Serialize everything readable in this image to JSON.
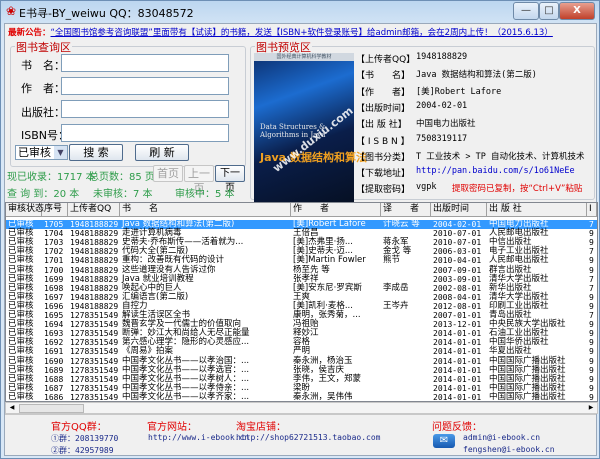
{
  "window": {
    "title": "E书寻-BY_weiwu QQ：83048572",
    "min": "—",
    "max": "□",
    "close": "X"
  },
  "notice": {
    "label": "最新公告：",
    "text": "“全国图书馆参考咨询联盟”里面带有【试读】的书籍，发送【ISBN+软件登录账号】给admin邮箱，会在2周内上传！（2015.6.13）"
  },
  "search": {
    "group_title": "图书查询区",
    "fields": [
      {
        "label": "书　名：",
        "value": ""
      },
      {
        "label": "作　者：",
        "value": ""
      },
      {
        "label": "出版社：",
        "value": ""
      },
      {
        "label": "ISBN号：",
        "value": ""
      }
    ],
    "status_select": "已审核",
    "search_button": "搜 索",
    "refresh_button": "刷 新"
  },
  "stats": {
    "collected": "现已收录：1717 本",
    "total_pages": "总页数：85 页",
    "found": "查 询 到：20 本",
    "unreviewed": "未审核：7 本",
    "reviewing": "审核中：5 本"
  },
  "pager": {
    "first": "首页",
    "prev": "上一页",
    "next": "下一页"
  },
  "preview": {
    "group_title": "图书预览区",
    "cover_top": "国外经典计算机科学教材",
    "cover_en": "Data Structures & Algorithms in Java",
    "cover_cn": "Java 数据结构和算法",
    "cover_watermark": "www.duxiu.com",
    "info": [
      {
        "k": "【上传者QQ】",
        "v": "1948188829"
      },
      {
        "k": "【书　　名】",
        "v": "Java 数据结构和算法(第二版)"
      },
      {
        "k": "【作　　者】",
        "v": "[美]Robert Lafore"
      },
      {
        "k": "【出版时间】",
        "v": "2004-02-01"
      },
      {
        "k": "【出 版 社】",
        "v": "中国电力出版社"
      },
      {
        "k": "【 I S B N 】",
        "v": "7508319117"
      },
      {
        "k": "【图书分类】",
        "v": "T 工业技术 > TP 自动化技术、计算机技术"
      },
      {
        "k": "【下载地址】",
        "v": "http://pan.baidu.com/s/1o61NeEe"
      },
      {
        "k": "【提取密码】",
        "v": "vgpk"
      }
    ],
    "copied_msg": "提取密码已复制，按“Ctrl+V”粘贴"
  },
  "table": {
    "headers": [
      "审核状态",
      "序号",
      "上传者QQ",
      "书　　名",
      "作　　者",
      "译　　者",
      "出版时间",
      "出 版 社",
      "I"
    ],
    "rows": [
      [
        "已审核",
        "1705",
        "1948188829",
        "Java 数据结构和算法(第二版)",
        "[美]Robert Lafore",
        "计晓云 等",
        "2004-02-01",
        "中国电力出版社",
        "7"
      ],
      [
        "已审核",
        "1704",
        "1948188829",
        "走进计算机病毒",
        "王倍昌",
        "",
        "2010-07-01",
        "人民邮电出版社",
        "9"
      ],
      [
        "已审核",
        "1703",
        "1948188829",
        "史蒂夫·乔布斯传——活着就为...",
        "[美]杰弗里·扬...",
        "蒋永军",
        "2010-07-01",
        "中信出版社",
        "9"
      ],
      [
        "已审核",
        "1702",
        "1948188829",
        "代码大全(第二版)",
        "[美]史蒂夫·迈...",
        "金戈 等",
        "2006-03-01",
        "电子工业出版社",
        "7"
      ],
      [
        "已审核",
        "1701",
        "1948188829",
        "重构：改善既有代码的设计",
        "[美]Martin Fowler",
        "熊节",
        "2010-04-01",
        "人民邮电出版社",
        "9"
      ],
      [
        "已审核",
        "1700",
        "1948188829",
        "这些道理没有人告诉过你",
        "杨至先 等",
        "",
        "2007-09-01",
        "群言出版社",
        "9"
      ],
      [
        "已审核",
        "1699",
        "1948188829",
        "Java 就业培训教程",
        "张孝祥",
        "",
        "2003-09-01",
        "清华大学出版社",
        "7"
      ],
      [
        "已审核",
        "1698",
        "1948188829",
        "唤起心中的巨人",
        "[美]安东尼·罗宾斯",
        "李成岳",
        "2002-08-01",
        "新华出版社",
        "7"
      ],
      [
        "已审核",
        "1697",
        "1948188829",
        "汇编语言(第二版)",
        "王爽",
        "",
        "2008-04-01",
        "清华大学出版社",
        "9"
      ],
      [
        "已审核",
        "1696",
        "1948188829",
        "自控力",
        "[美]凯利·麦格...",
        "王岑卉",
        "2012-08-01",
        "印刷工业出版社",
        "9"
      ],
      [
        "已审核",
        "1695",
        "1278351549",
        "解读生活误区全书",
        "康明，张秀菊，...",
        "",
        "2007-01-01",
        "青岛出版社",
        "7"
      ],
      [
        "已审核",
        "1694",
        "1278351549",
        "魏晋玄学及一代儒士的价值取向",
        "冯祖贻",
        "",
        "2013-12-01",
        "中央民族大学出版社",
        "9"
      ],
      [
        "已审核",
        "1693",
        "1278351549",
        "断弹：妙江大和尚给人无尽正能量",
        "释妙江",
        "",
        "2014-01-01",
        "石油工业出版社",
        "9"
      ],
      [
        "已审核",
        "1692",
        "1278351549",
        "第六感心理学：隐形的心灵感应...",
        "容格",
        "",
        "2014-01-01",
        "中国华侨出版社",
        "9"
      ],
      [
        "已审核",
        "1691",
        "1278351549",
        "《周易》拍案",
        "严明",
        "",
        "2014-01-01",
        "华夏出版社",
        "9"
      ],
      [
        "已审核",
        "1690",
        "1278351549",
        "中国孝文化丛书——以孝治国：...",
        "秦永洲，杨治玉",
        "",
        "2014-01-01",
        "中国国际广播出版社",
        "9"
      ],
      [
        "已审核",
        "1689",
        "1278351549",
        "中国孝文化丛书——以孝选官：...",
        "张晓，侯吉庆",
        "",
        "2014-01-01",
        "中国国际广播出版社",
        "9"
      ],
      [
        "已审核",
        "1688",
        "1278351549",
        "中国孝文化丛书——以孝树人：...",
        "李伟，王文，郑蒙",
        "",
        "2014-01-01",
        "中国国际广播出版社",
        "9"
      ],
      [
        "已审核",
        "1687",
        "1278351549",
        "中国孝文化丛书——以孝侍亲：...",
        "梁盼",
        "",
        "2014-01-01",
        "中国国际广播出版社",
        "9"
      ],
      [
        "已审核",
        "1686",
        "1278351549",
        "中国孝文化丛书——以孝齐家：...",
        "秦永洲，吴伟伟",
        "",
        "2014-01-01",
        "中国国际广播出版社",
        "9"
      ]
    ]
  },
  "footer": {
    "qq_title": "官方QQ群：",
    "qq1": "①群：208139770",
    "qq2": "②群：42957989",
    "site_title": "官方网站：",
    "site": "http://www.i-ebook.cn",
    "shop_title": "淘宝店铺：",
    "shop": "http://shop62721513.taobao.com",
    "feedback_title": "问题反馈：",
    "email1": "admin@i-ebook.cn",
    "email2": "fengshen@i-ebook.cn"
  }
}
